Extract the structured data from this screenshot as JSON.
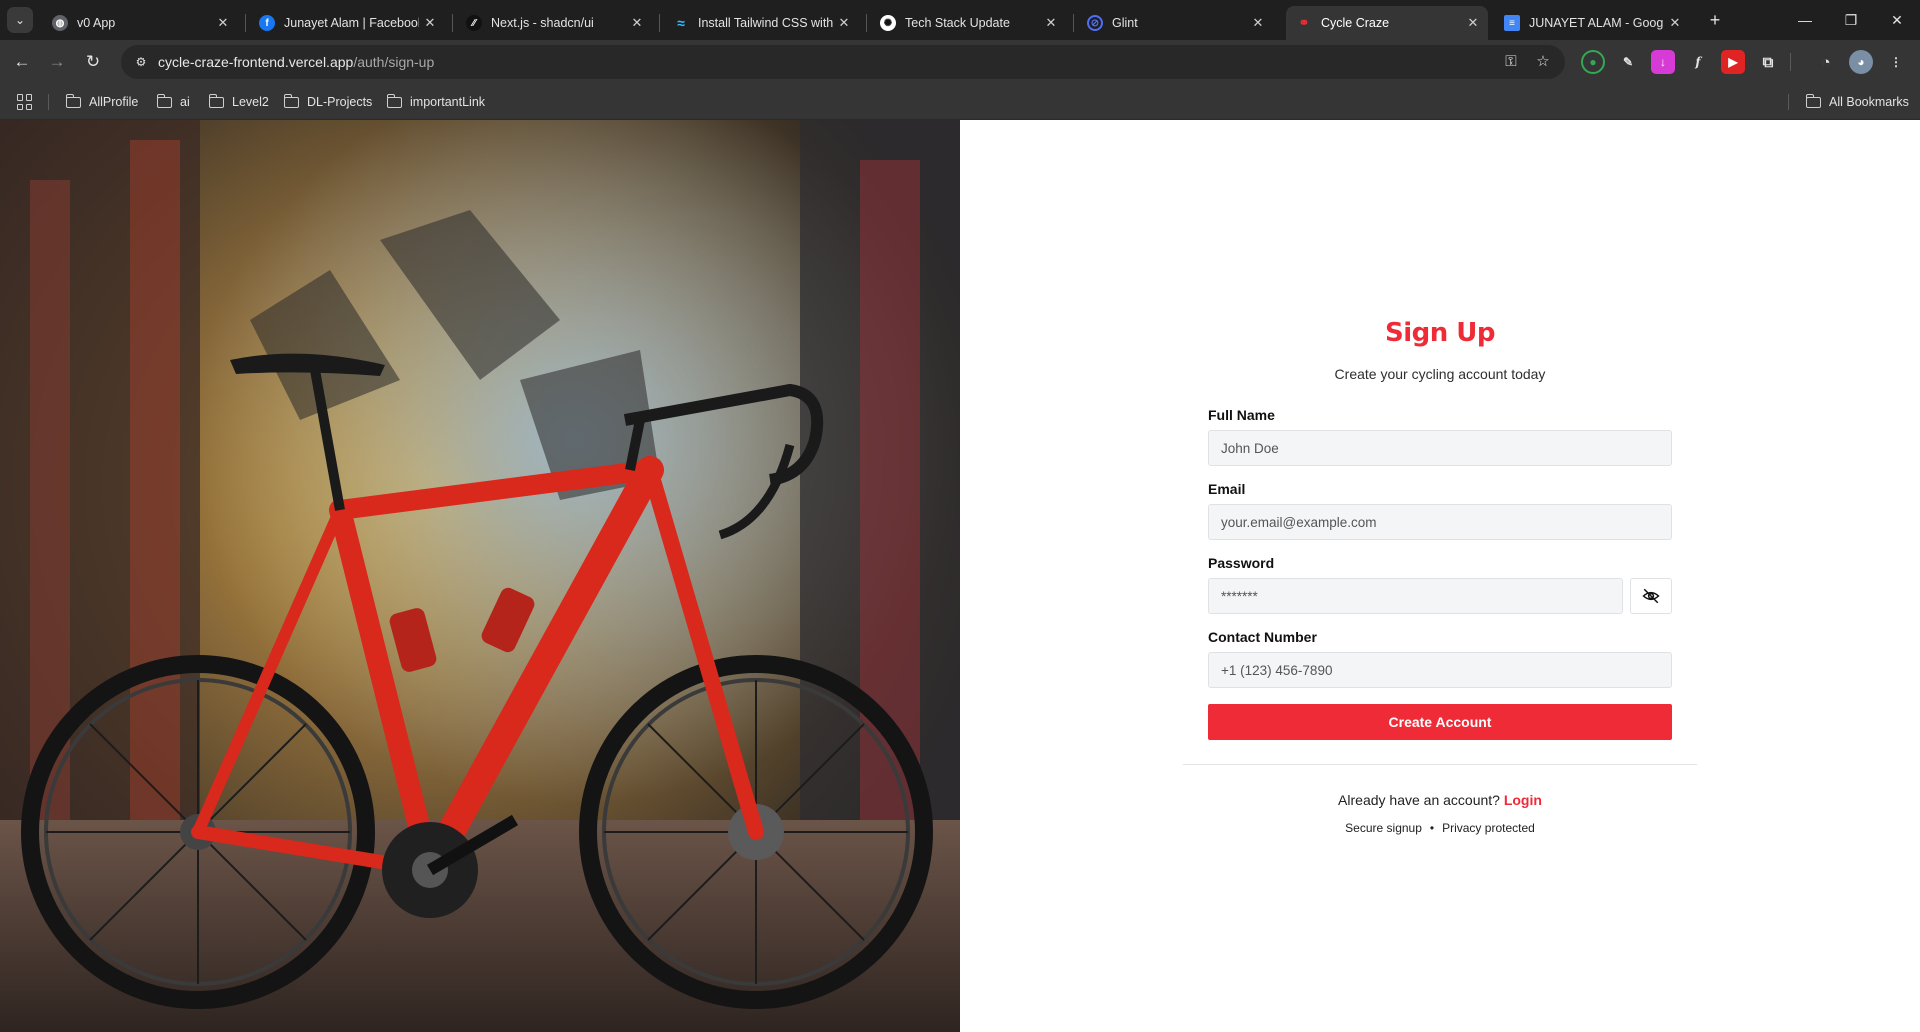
{
  "browser": {
    "tabs": [
      {
        "title": "v0 App",
        "icon": "globe-icon",
        "color": "#5f6368"
      },
      {
        "title": "Junayet Alam | Facebook",
        "icon": "facebook-icon",
        "color": "#1877f2"
      },
      {
        "title": "Next.js - shadcn/ui",
        "icon": "shadcn-icon",
        "color": "#111111"
      },
      {
        "title": "Install Tailwind CSS with N",
        "icon": "tailwind-icon",
        "color": "#38bdf8"
      },
      {
        "title": "Tech Stack Update",
        "icon": "chatgpt-icon",
        "color": "#ffffff"
      },
      {
        "title": "Glint",
        "icon": "glint-icon",
        "color": "#4f6ef7"
      },
      {
        "title": "Cycle Craze",
        "icon": "cycle-craze-icon",
        "color": "#ef2b37",
        "active": true
      },
      {
        "title": "JUNAYET ALAM - Google",
        "icon": "google-docs-icon",
        "color": "#4285f4"
      }
    ],
    "url_host": "cycle-craze-frontend.vercel.app",
    "url_path": "/auth/sign-up",
    "bookmarks": [
      "AllProfile",
      "ai",
      "Level2",
      "DL-Projects",
      "importantLink"
    ],
    "all_bookmarks": "All Bookmarks"
  },
  "form": {
    "title": "Sign Up",
    "subtitle": "Create your cycling account today",
    "full_name_label": "Full Name",
    "full_name_placeholder": "John Doe",
    "email_label": "Email",
    "email_placeholder": "your.email@example.com",
    "password_label": "Password",
    "password_placeholder": "*******",
    "contact_label": "Contact Number",
    "contact_placeholder": "+1 (123) 456-7890",
    "submit_label": "Create Account",
    "login_prompt": "Already have an account?",
    "login_link": "Login",
    "trust_1": "Secure signup",
    "trust_2": "Privacy protected",
    "accent_color": "#ef2b37"
  }
}
